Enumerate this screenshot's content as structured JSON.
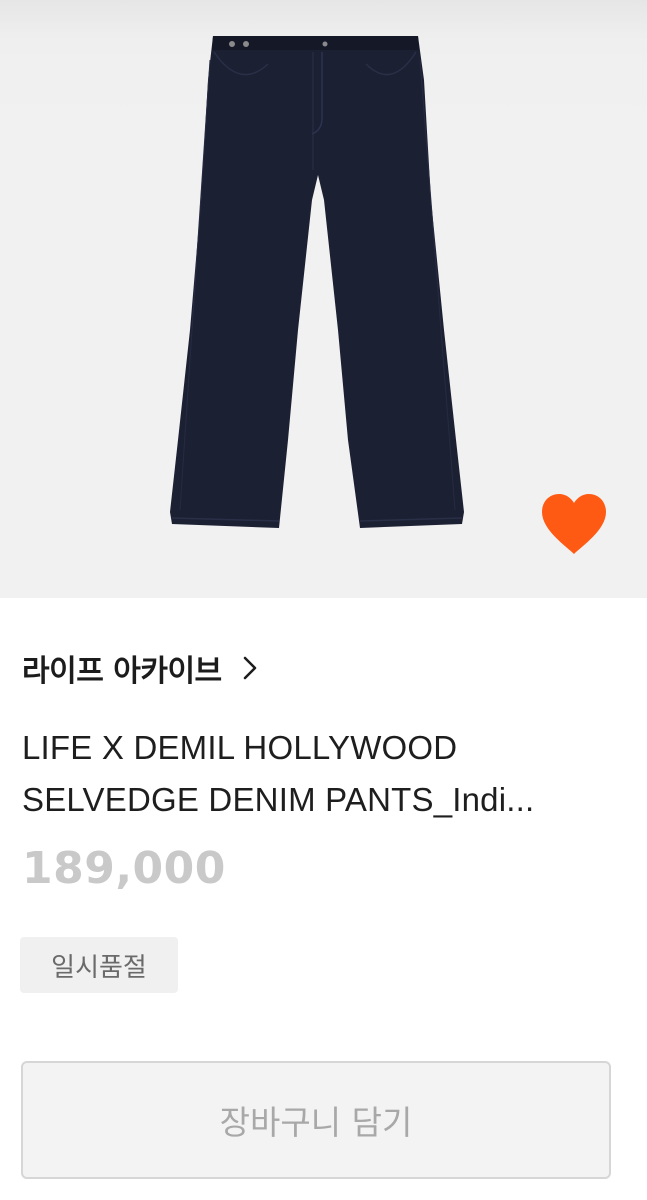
{
  "product": {
    "brand": "라이프 아카이브",
    "title_line1": "LIFE X DEMIL HOLLYWOOD",
    "title_line2": "SELVEDGE DENIM PANTS_Indi...",
    "price": "189,000",
    "status": "일시품절",
    "image_icon": "denim-pants-image",
    "accent_color": "#ff5a14"
  },
  "actions": {
    "wishlist_icon": "heart-icon",
    "brand_link_icon": "chevron-right-icon",
    "cart_label": "장바구니 담기"
  }
}
